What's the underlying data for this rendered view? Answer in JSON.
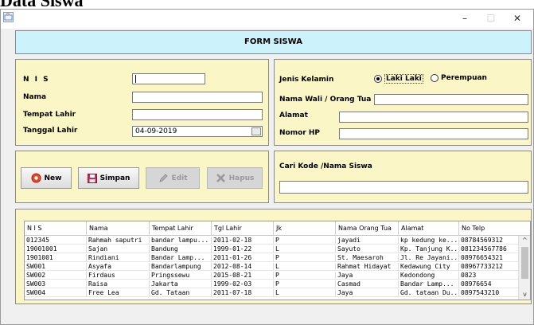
{
  "page_heading": "Data Siswa",
  "window": {
    "controls": {
      "minimize": "–",
      "maximize": "☐",
      "close": "✕"
    }
  },
  "header": {
    "title": "FORM SISWA"
  },
  "form": {
    "nis_label": "N I S",
    "nis_value": "",
    "nama_label": "Nama",
    "nama_value": "",
    "tempat_lahir_label": "Tempat Lahir",
    "tempat_lahir_value": "",
    "tanggal_lahir_label": "Tanggal Lahir",
    "tanggal_lahir_value": "04-09-2019",
    "jenis_kelamin_label": "Jenis Kelamin",
    "gender_options": [
      "Laki Laki",
      "Perempuan"
    ],
    "gender_selected": "Laki Laki",
    "nama_wali_label": "Nama Wali / Orang Tua",
    "nama_wali_value": "",
    "alamat_label": "Alamat",
    "alamat_value": "",
    "nomor_hp_label": "Nomor HP",
    "nomor_hp_value": ""
  },
  "buttons": {
    "new": "New",
    "simpan": "Simpan",
    "edit": "Edit",
    "hapus": "Hapus"
  },
  "search": {
    "label": "Cari Kode /Nama Siswa",
    "value": ""
  },
  "table": {
    "columns": [
      "N I S",
      "Nama",
      "Tempat Lahir",
      "Tgl Lahir",
      "Jk",
      "Nama Orang Tua",
      "Alamat",
      "No Telp"
    ],
    "rows": [
      [
        "012345",
        "Rahmah saputri",
        "bandar lampu...",
        "2011-02-18",
        "P",
        "jayadi",
        "kp kedung ke...",
        "08784569312"
      ],
      [
        "19001001",
        "Sajan",
        "Bandung",
        "1999-01-22",
        "L",
        "Sayuto",
        "Kp. Tanjung K...",
        "081234567786"
      ],
      [
        "1901001",
        "Rindiani",
        "Bandar Lamp...",
        "2011-01-26",
        "P",
        "St. Maesaroh",
        "Jl. Re Jayani...",
        "08976654321"
      ],
      [
        "SW001",
        "Asyafa",
        "Bandarlampung",
        "2012-08-14",
        "L",
        "Rahmat Hidayat",
        "Kedawung City",
        "08967733212"
      ],
      [
        "SW002",
        "Firdaus",
        "Pringssewu",
        "2015-08-21",
        "P",
        "Jaya",
        "Kedondong",
        "0823"
      ],
      [
        "SW003",
        "Raisa",
        "Jakarta",
        "1999-02-03",
        "P",
        "Casmad",
        "Bandar Lamp...",
        "08976654"
      ],
      [
        "SW004",
        "Free Lea",
        "Gd. Tataan",
        "2011-07-18",
        "L",
        "Jaya",
        "Gd. tataan Du...",
        "0897543210"
      ]
    ]
  },
  "colors": {
    "header_bg": "#ccf2fc",
    "panel_bg": "#fbf6c6",
    "window_bg": "#f0f0f0",
    "new_icon": "#e8472a",
    "save_icon": "#c0305a"
  }
}
